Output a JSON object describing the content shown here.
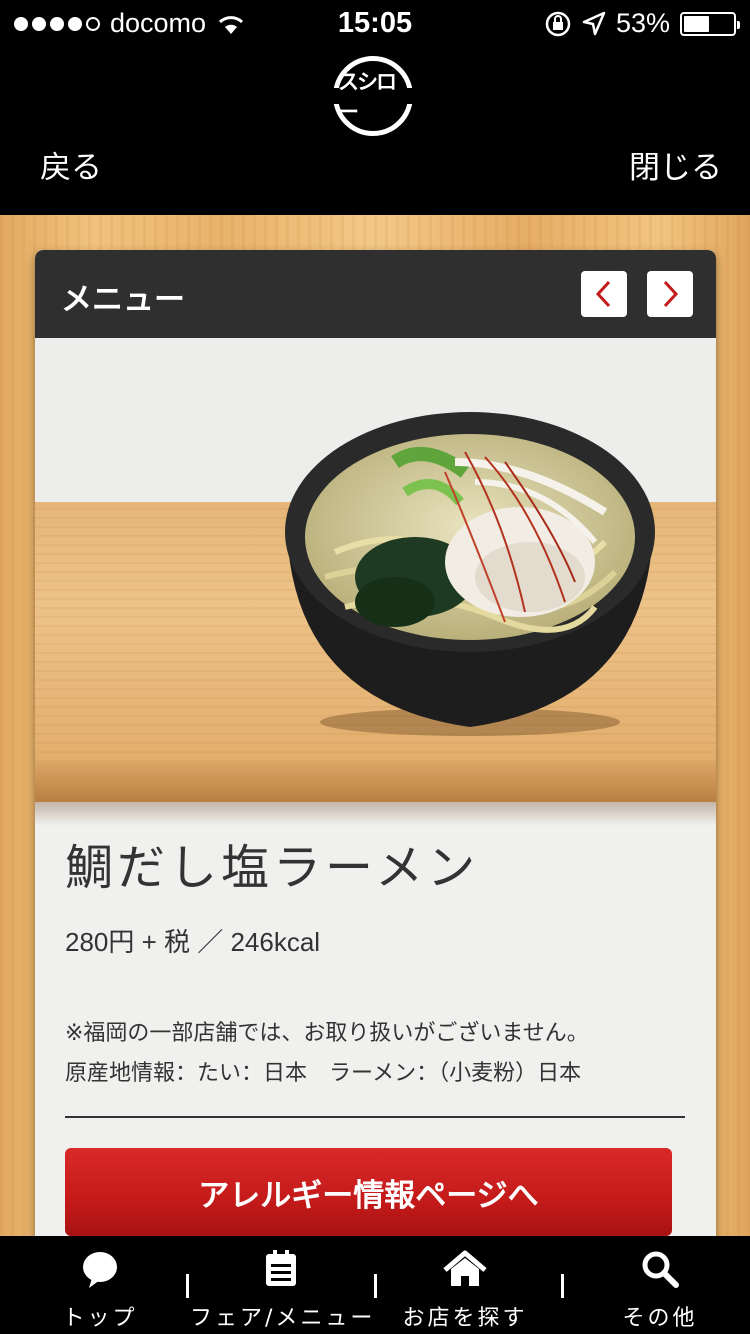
{
  "status_bar": {
    "carrier": "docomo",
    "time": "15:05",
    "battery_percent_text": "53%",
    "battery_level": 0.53
  },
  "nav": {
    "logo_text": "スシロー",
    "back_label": "戻る",
    "close_label": "閉じる"
  },
  "card": {
    "title": "メニュー",
    "prev_icon": "chevron-left-icon",
    "next_icon": "chevron-right-icon"
  },
  "item": {
    "name": "鯛だし塩ラーメン",
    "price_line": "280円 + 税 ／ 246kcal",
    "note_line1": "※福岡の一部店舗では、お取り扱いがございません。",
    "note_line2": "原産地情報：たい：日本　ラーメン：（小麦粉）日本",
    "allergy_button": "アレルギー情報ページへ"
  },
  "tabs": [
    {
      "label": "トップ",
      "icon": "speech-bubble-icon"
    },
    {
      "label": "フェア/メニュー",
      "icon": "menu-list-icon"
    },
    {
      "label": "お店を探す",
      "icon": "home-icon"
    },
    {
      "label": "その他",
      "icon": "search-icon"
    }
  ],
  "colors": {
    "accent_red": "#c41a1a",
    "header_dark": "#2f2f2f",
    "wood": "#e8b36b"
  }
}
